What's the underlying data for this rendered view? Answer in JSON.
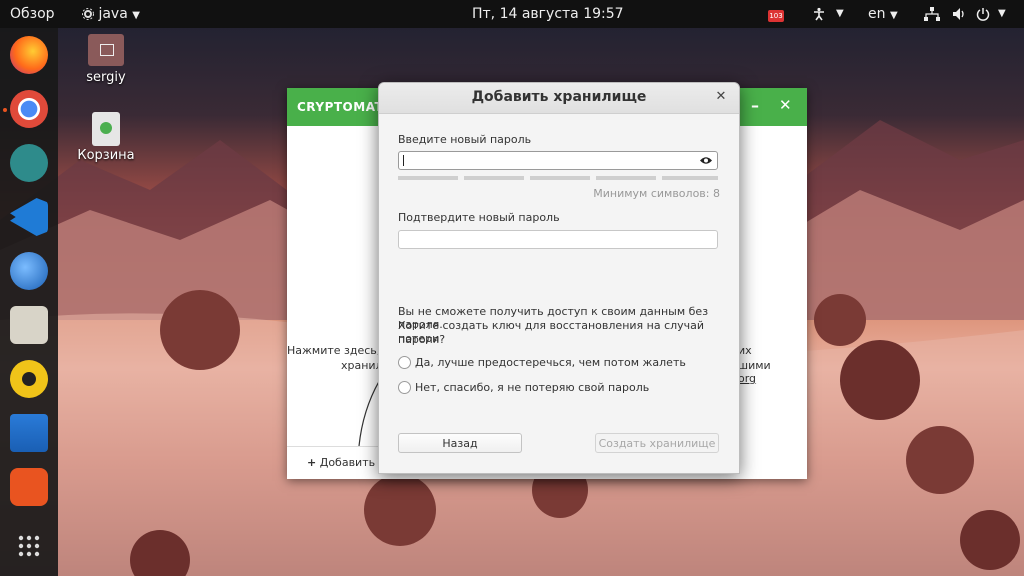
{
  "topbar": {
    "activities": "Обзор",
    "app_menu": "java",
    "clock": "Пт, 14 августа  19:57",
    "lang": "en",
    "tray_badge": "103"
  },
  "desktop": {
    "icons": [
      {
        "label": "sergiy",
        "icon": "home-folder-icon"
      },
      {
        "label": "Корзина",
        "icon": "trash-icon"
      }
    ]
  },
  "dock": {
    "apps": [
      "firefox-icon",
      "chrome-icon",
      "remmina-icon",
      "vscode-icon",
      "thunderbird-icon",
      "files-icon",
      "rhythmbox-icon",
      "libreoffice-writer-icon",
      "software-center-icon",
      "show-apps-icon"
    ]
  },
  "app_window": {
    "title": "CRYPTOMATO",
    "left_text_1": "Нажмите здесь, чт",
    "left_text_2": "хранил",
    "right_text_1": "их",
    "right_text_2": "шими",
    "right_text_3": "org",
    "add_button": "Добавить х"
  },
  "dialog": {
    "title": "Добавить хранилище",
    "password_label": "Введите новый пароль",
    "min_chars": "Минимум символов: 8",
    "confirm_label": "Подтвердите новый пароль",
    "warning_line1": "Вы не сможете получить доступ к своим данным без пароля.",
    "warning_line2": "Хотите создать ключ для восстановления на случай потери",
    "warning_line3": "пароля?",
    "option_yes": "Да, лучше предостеречься, чем потом жалеть",
    "option_no": "Нет, спасибо, я не потеряю свой пароль",
    "back_button": "Назад",
    "create_button": "Создать хранилище"
  },
  "colors": {
    "accent_green": "#49b04a",
    "topbar": "#111111",
    "ubuntu_orange": "#e95420"
  }
}
